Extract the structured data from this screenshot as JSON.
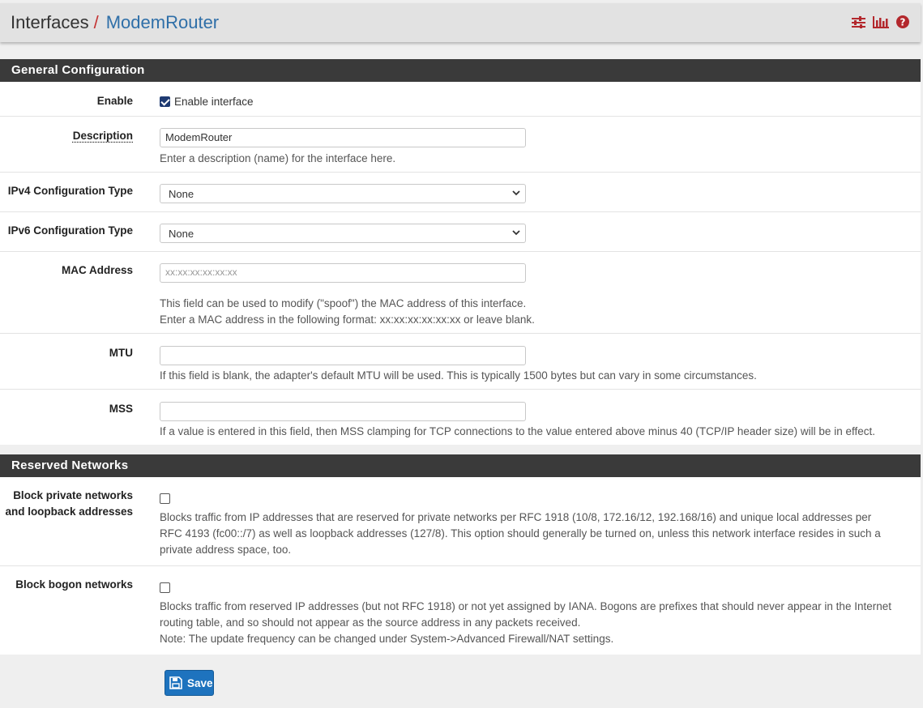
{
  "breadcrumb": {
    "section": "Interfaces",
    "separator": "/",
    "current": "ModemRouter"
  },
  "header_icons": [
    "sliders-icon",
    "bar-chart-icon",
    "help-icon"
  ],
  "colors": {
    "accent_red": "#c43434",
    "link_blue": "#2f6fa8",
    "section_bar": "#3a3a3a",
    "save_blue": "#1e73be"
  },
  "general": {
    "title": "General Configuration",
    "enable": {
      "label": "Enable",
      "checkbox_label": "Enable interface",
      "checked": true
    },
    "description": {
      "label": "Description",
      "value": "ModemRouter",
      "help": "Enter a description (name) for the interface here."
    },
    "ipv4": {
      "label": "IPv4 Configuration Type",
      "value": "None"
    },
    "ipv6": {
      "label": "IPv6 Configuration Type",
      "value": "None"
    },
    "mac": {
      "label": "MAC Address",
      "placeholder": "xx:xx:xx:xx:xx:xx",
      "help1": "This field can be used to modify (\"spoof\") the MAC address of this interface.",
      "help2": "Enter a MAC address in the following format: xx:xx:xx:xx:xx:xx or leave blank."
    },
    "mtu": {
      "label": "MTU",
      "value": "",
      "help": "If this field is blank, the adapter's default MTU will be used. This is typically 1500 bytes but can vary in some circumstances."
    },
    "mss": {
      "label": "MSS",
      "value": "",
      "help": "If a value is entered in this field, then MSS clamping for TCP connections to the value entered above minus 40 (TCP/IP header size) will be in effect."
    }
  },
  "reserved": {
    "title": "Reserved Networks",
    "private": {
      "label1": "Block private networks",
      "label2": "and loopback addresses",
      "checked": false,
      "help1": "Blocks traffic from IP addresses that are reserved for private networks per RFC 1918 (10/8, 172.16/12, 192.168/16) and unique local addresses per",
      "help2": "RFC 4193 (fc00::/7) as well as loopback addresses (127/8). This option should generally be turned on, unless this network interface resides in such a",
      "help3": "private address space, too."
    },
    "bogon": {
      "label": "Block bogon networks",
      "checked": false,
      "help1": "Blocks traffic from reserved IP addresses (but not RFC 1918) or not yet assigned by IANA. Bogons are prefixes that should never appear in the Internet",
      "help2": "routing table, and so should not appear as the source address in any packets received.",
      "help3": "Note: The update frequency can be changed under System->Advanced Firewall/NAT settings."
    }
  },
  "save_label": "Save"
}
